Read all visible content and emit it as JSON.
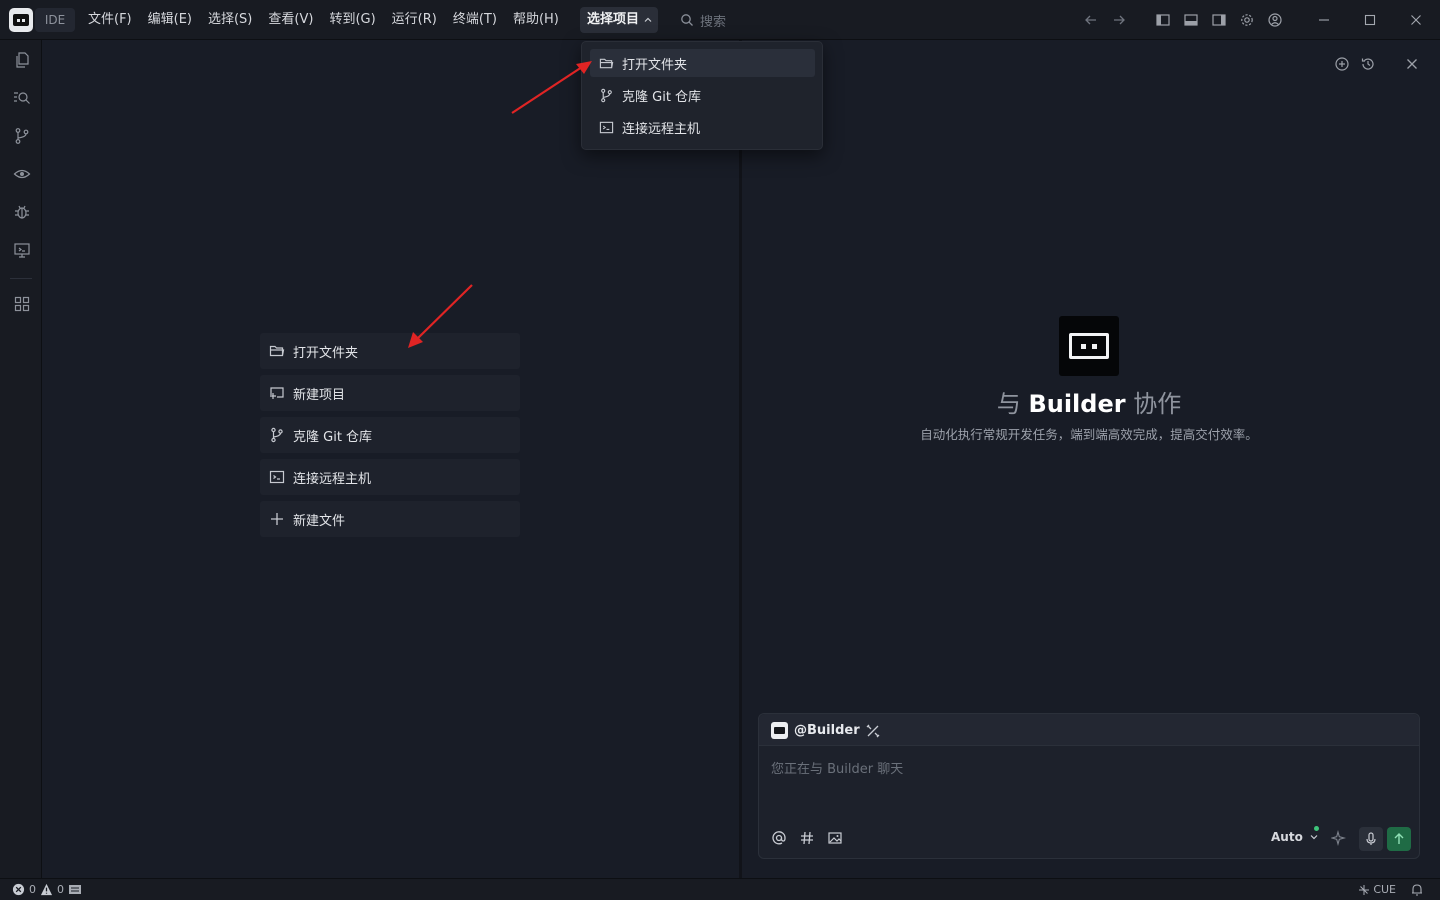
{
  "titlebar": {
    "ide_label": "IDE",
    "menu": [
      "文件(F)",
      "编辑(E)",
      "选择(S)",
      "查看(V)",
      "转到(G)",
      "运行(R)",
      "终端(T)",
      "帮助(H)"
    ],
    "project_button": "选择项目",
    "search_placeholder": "搜索"
  },
  "project_dropdown": {
    "items": [
      {
        "label": "打开文件夹",
        "icon": "folder-open-icon"
      },
      {
        "label": "克隆 Git 仓库",
        "icon": "git-branch-icon"
      },
      {
        "label": "连接远程主机",
        "icon": "remote-icon"
      }
    ]
  },
  "welcome": {
    "actions": [
      {
        "label": "打开文件夹",
        "icon": "folder-open-icon"
      },
      {
        "label": "新建项目",
        "icon": "new-project-icon"
      },
      {
        "label": "克隆 Git 仓库",
        "icon": "git-branch-icon"
      },
      {
        "label": "连接远程主机",
        "icon": "remote-icon"
      },
      {
        "label": "新建文件",
        "icon": "plus-icon"
      }
    ]
  },
  "chat": {
    "title_prefix": "与",
    "title_strong": "Builder",
    "title_suffix": "协作",
    "subtitle": "自动化执行常规开发任务，端到端高效完成，提高交付效率。",
    "agent_label": "@Builder",
    "input_placeholder": "您正在与 Builder 聊天",
    "model_select": "Auto"
  },
  "statusbar": {
    "errors": "0",
    "warnings": "0",
    "right_label": "CUE"
  },
  "colors": {
    "accent_send": "#1f6b45",
    "annotation_arrow": "#e02424",
    "online_dot": "#3ec47a"
  }
}
